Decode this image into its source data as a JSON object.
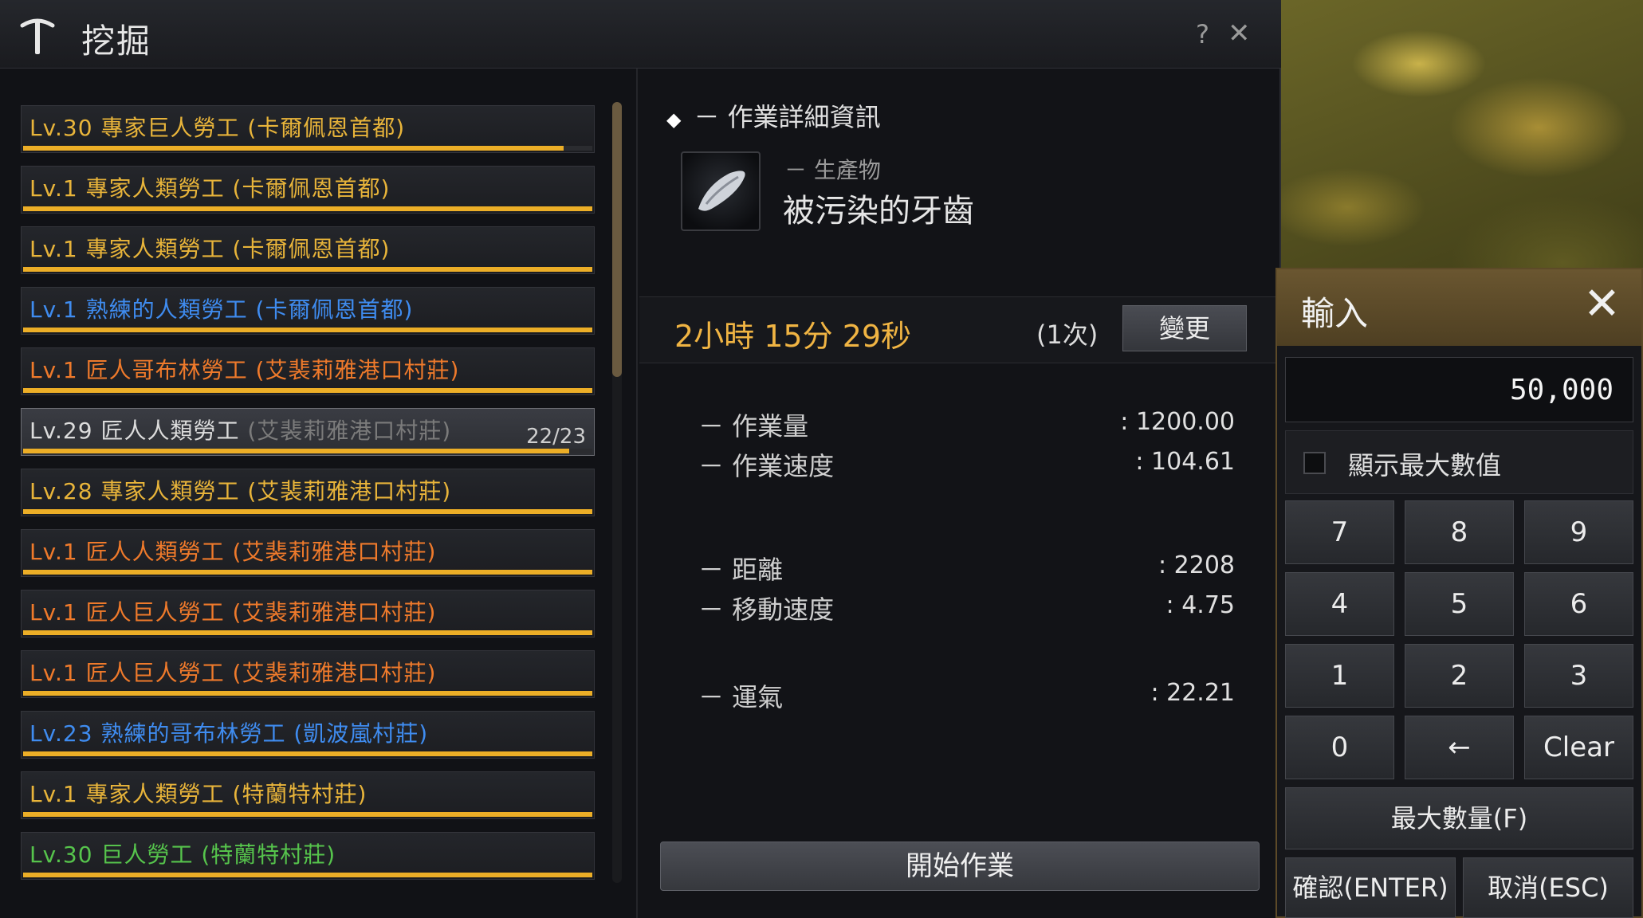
{
  "window": {
    "title": "挖掘",
    "help_label": "?",
    "close_label": "✕"
  },
  "workers": [
    {
      "level": "Lv.30",
      "name": "專家巨人勞工",
      "location": "(卡爾佩恩首都)",
      "color": "#e8b43a",
      "stamina": 0.95
    },
    {
      "level": "Lv.1",
      "name": "專家人類勞工",
      "location": "(卡爾佩恩首都)",
      "color": "#e8b43a",
      "stamina": 1.0
    },
    {
      "level": "Lv.1",
      "name": "專家人類勞工",
      "location": "(卡爾佩恩首都)",
      "color": "#e8b43a",
      "stamina": 1.0
    },
    {
      "level": "Lv.1",
      "name": "熟練的人類勞工",
      "location": "(卡爾佩恩首都)",
      "color": "#3f8cf0",
      "stamina": 1.0
    },
    {
      "level": "Lv.1",
      "name": "匠人哥布林勞工",
      "location": "(艾裴莉雅港口村莊)",
      "color": "#ef7a2b",
      "stamina": 1.0
    },
    {
      "level": "Lv.29",
      "name": "匠人人類勞工",
      "location": "(艾裴莉雅港口村莊)",
      "color": "#dcdcdc",
      "stamina": 0.96,
      "count": "22/23",
      "selected": true
    },
    {
      "level": "Lv.28",
      "name": "專家人類勞工",
      "location": "(艾裴莉雅港口村莊)",
      "color": "#e8b43a",
      "stamina": 1.0
    },
    {
      "level": "Lv.1",
      "name": "匠人人類勞工",
      "location": "(艾裴莉雅港口村莊)",
      "color": "#ef7a2b",
      "stamina": 1.0
    },
    {
      "level": "Lv.1",
      "name": "匠人巨人勞工",
      "location": "(艾裴莉雅港口村莊)",
      "color": "#ef7a2b",
      "stamina": 1.0
    },
    {
      "level": "Lv.1",
      "name": "匠人巨人勞工",
      "location": "(艾裴莉雅港口村莊)",
      "color": "#ef7a2b",
      "stamina": 1.0
    },
    {
      "level": "Lv.23",
      "name": "熟練的哥布林勞工",
      "location": "(凱波嵐村莊)",
      "color": "#3f8cf0",
      "stamina": 1.0
    },
    {
      "level": "Lv.1",
      "name": "專家人類勞工",
      "location": "(特蘭特村莊)",
      "color": "#e8b43a",
      "stamina": 1.0
    },
    {
      "level": "Lv.30",
      "name": "巨人勞工",
      "location": "(特蘭特村莊)",
      "color": "#56c44c",
      "stamina": 1.0
    }
  ],
  "detail": {
    "section_title": "－ 作業詳細資訊",
    "product_sub": "－ 生產物",
    "product_name": "被污染的牙齒",
    "time": "2小時 15分 29秒",
    "count": "(1次)",
    "change_label": "變更",
    "stats": [
      {
        "label": "－ 作業量",
        "value": ": 1200.00"
      },
      {
        "label": "－ 作業速度",
        "value": ": 104.61"
      },
      {
        "label": "－ 距離",
        "value": ": 2208"
      },
      {
        "label": "－ 移動速度",
        "value": ": 4.75"
      },
      {
        "label": "－ 運氣",
        "value": ": 22.21"
      }
    ],
    "start_label": "開始作業"
  },
  "input_dialog": {
    "title": "輸入",
    "close_label": "✕",
    "value": "50,000",
    "show_max_label": "顯示最大數值",
    "show_max_checked": false,
    "keys": [
      "7",
      "8",
      "9",
      "4",
      "5",
      "6",
      "1",
      "2",
      "3",
      "0",
      "←",
      "Clear"
    ],
    "max_label": "最大數量(F)",
    "confirm_label": "確認(ENTER)",
    "cancel_label": "取消(ESC)"
  },
  "colors": {
    "gold": "#e8b43a",
    "orange": "#ef7a2b",
    "blue": "#3f8cf0",
    "green": "#56c44c",
    "bar": "#ecae27",
    "dialog_header": "#6a5630"
  }
}
